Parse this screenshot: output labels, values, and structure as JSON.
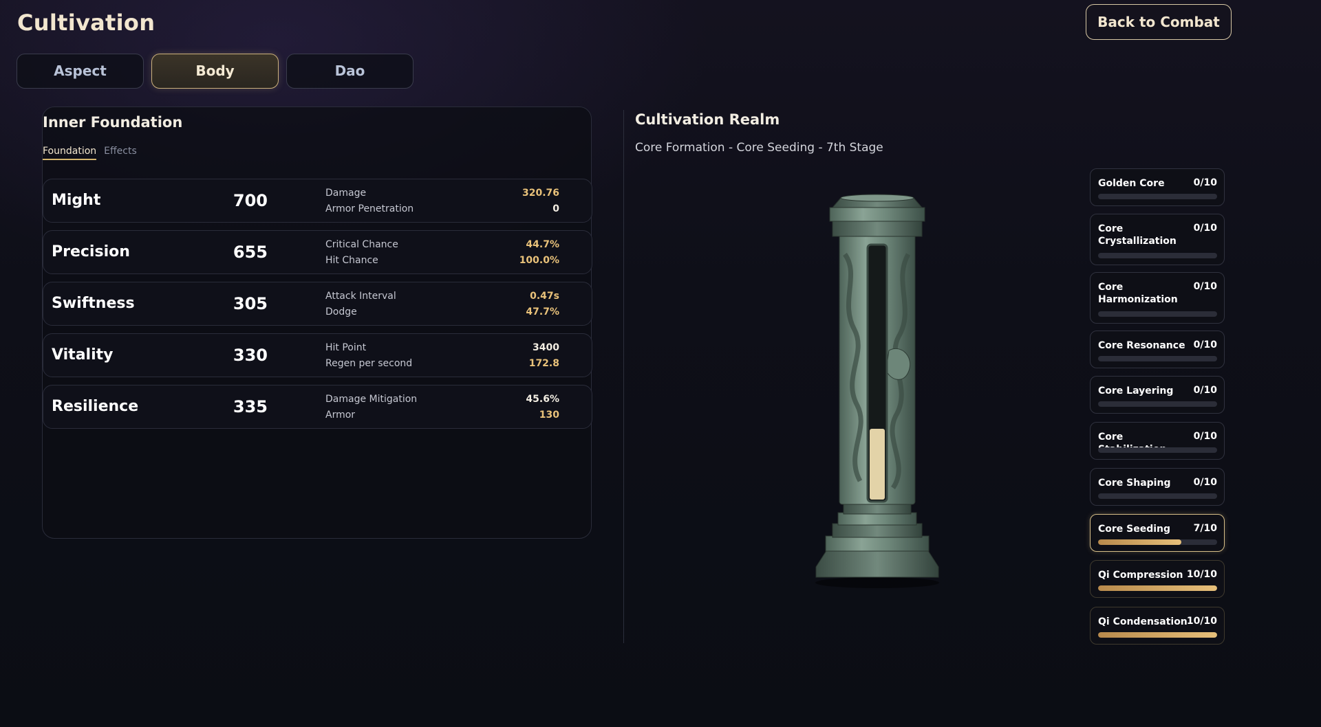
{
  "header": {
    "title": "Cultivation",
    "back_label": "Back to Combat"
  },
  "tabs": [
    {
      "label": "Aspect",
      "active": false
    },
    {
      "label": "Body",
      "active": true
    },
    {
      "label": "Dao",
      "active": false
    }
  ],
  "foundation": {
    "title": "Inner Foundation",
    "subtabs": [
      {
        "label": "Foundation",
        "active": true
      },
      {
        "label": "Effects",
        "active": false
      }
    ],
    "stats": [
      {
        "name": "Might",
        "value": "700",
        "effects": [
          {
            "label": "Damage",
            "value": "320.76",
            "color": "#e9c27a"
          },
          {
            "label": "Armor Penetration",
            "value": "0",
            "color": "#f2ede2"
          }
        ]
      },
      {
        "name": "Precision",
        "value": "655",
        "effects": [
          {
            "label": "Critical Chance",
            "value": "44.7%",
            "color": "#e9c27a"
          },
          {
            "label": "Hit Chance",
            "value": "100.0%",
            "color": "#e9c27a"
          }
        ]
      },
      {
        "name": "Swiftness",
        "value": "305",
        "effects": [
          {
            "label": "Attack Interval",
            "value": "0.47s",
            "color": "#e9c27a"
          },
          {
            "label": "Dodge",
            "value": "47.7%",
            "color": "#e9c27a"
          }
        ]
      },
      {
        "name": "Vitality",
        "value": "330",
        "effects": [
          {
            "label": "Hit Point",
            "value": "3400",
            "color": "#f2ede2"
          },
          {
            "label": "Regen per second",
            "value": "172.8",
            "color": "#e9c27a"
          }
        ]
      },
      {
        "name": "Resilience",
        "value": "335",
        "effects": [
          {
            "label": "Damage Mitigation",
            "value": "45.6%",
            "color": "#f2ede2"
          },
          {
            "label": "Armor",
            "value": "130",
            "color": "#e9c27a"
          }
        ]
      }
    ]
  },
  "realm": {
    "title": "Cultivation Realm",
    "subtitle": "Core Formation - Core Seeding - 7th Stage",
    "pillar_icon": "dragon-pillar-icon",
    "pillar_fill_fraction": 0.28,
    "stages": [
      {
        "name": "Golden Core",
        "progress": "0/10",
        "fraction": 0.0,
        "state": "locked"
      },
      {
        "name": "Core Crystallization",
        "progress": "0/10",
        "fraction": 0.0,
        "state": "locked"
      },
      {
        "name": "Core Harmonization",
        "progress": "0/10",
        "fraction": 0.0,
        "state": "locked"
      },
      {
        "name": "Core Resonance",
        "progress": "0/10",
        "fraction": 0.0,
        "state": "locked"
      },
      {
        "name": "Core Layering",
        "progress": "0/10",
        "fraction": 0.0,
        "state": "locked"
      },
      {
        "name": "Core Stabilization",
        "progress": "0/10",
        "fraction": 0.0,
        "state": "locked"
      },
      {
        "name": "Core Shaping",
        "progress": "0/10",
        "fraction": 0.0,
        "state": "locked"
      },
      {
        "name": "Core Seeding",
        "progress": "7/10",
        "fraction": 0.7,
        "state": "current"
      },
      {
        "name": "Qi Compression",
        "progress": "10/10",
        "fraction": 1.0,
        "state": "done"
      },
      {
        "name": "Qi Condensation",
        "progress": "10/10",
        "fraction": 1.0,
        "state": "done"
      }
    ]
  },
  "colors": {
    "accent_gold": "#e9c27a",
    "active_border": "#cdb27d",
    "bar_fill": "#d9b06a"
  }
}
